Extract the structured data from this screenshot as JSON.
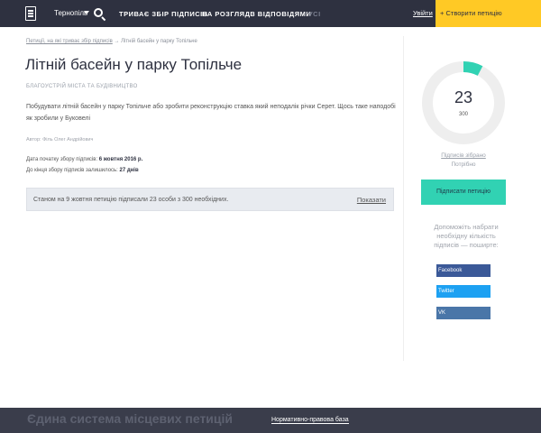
{
  "header": {
    "city": "Тернопіль",
    "nav": [
      "ТРИВАЄ ЗБІР ПІДПИСІВ",
      "НА РОЗГЛЯДІ",
      "З ВІДПОВІДЯМИ",
      "УСІ"
    ],
    "login": "Увійти",
    "create_button": "+ Створити петицію"
  },
  "breadcrumb": {
    "link": "Петиції, на які триває збір підписів",
    "separator": "→",
    "current": "Літній басейн у парку Топільче"
  },
  "petition": {
    "title": "Літній басейн у парку Топільче",
    "category": "БЛАГОУСТРІЙ МІСТА ТА БУДІВНИЦТВО",
    "description": "Побудувати літній басейн у парку Топільче або зробити реконструкцію ставка який неподалік річки Серет. Щось таке наподобі як зробили у Буковелі",
    "author": "Автор: Філь Олег Андрійович",
    "start_label": "Дата початку збору підписів:",
    "start_date": "6 жовтня 2016 р.",
    "remaining_label": "До кінця збору підписів залишилось:",
    "remaining": "27 днів",
    "status_text": "Станом на 9 жовтня петицію підписали 23 особи з 300 необхідних.",
    "show_link": "Показати"
  },
  "sidebar": {
    "signatures": "23",
    "required": "300",
    "progress_fraction": 0.0767,
    "collected_label": "Підписів зібрано",
    "needed_label": "Потрібно",
    "sign_button": "Підписати петицію",
    "share_text": "Допоможіть набрати необхідну кількість підписів — поширте:",
    "share": [
      "Facebook",
      "Twitter",
      "VK"
    ]
  },
  "footer": {
    "title": "Єдина система місцевих петицій",
    "link": "Нормативно-правова база"
  },
  "colors": {
    "header_bg": "#2e3140",
    "accent_yellow": "#ffc925",
    "accent_teal": "#31d2b3",
    "facebook": "#3b5998",
    "twitter": "#1da1f2",
    "vk": "#4a76a8"
  }
}
